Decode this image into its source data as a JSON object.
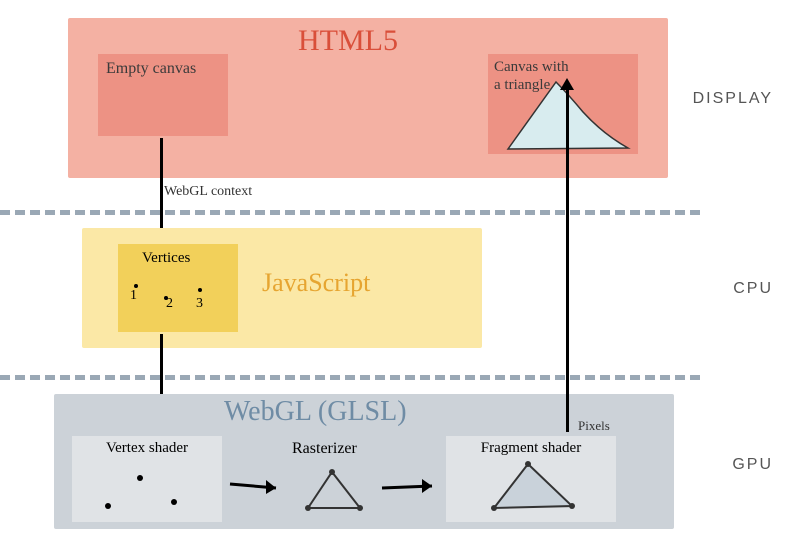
{
  "diagram": {
    "display": {
      "title": "HTML5",
      "empty_canvas": "Empty canvas",
      "canvas_triangle": "Canvas with\na triangle",
      "context_label": "WebGL context",
      "layer": "DISPLAY"
    },
    "cpu": {
      "vertices_label": "Vertices",
      "v1": "1",
      "v2": "2",
      "v3": "3",
      "title": "JavaScript",
      "layer": "CPU"
    },
    "gpu": {
      "title": "WebGL (GLSL)",
      "vertex_shader": "Vertex shader",
      "rasterizer": "Rasterizer",
      "fragment_shader": "Fragment shader",
      "pixels_label": "Pixels",
      "layer": "GPU"
    }
  }
}
